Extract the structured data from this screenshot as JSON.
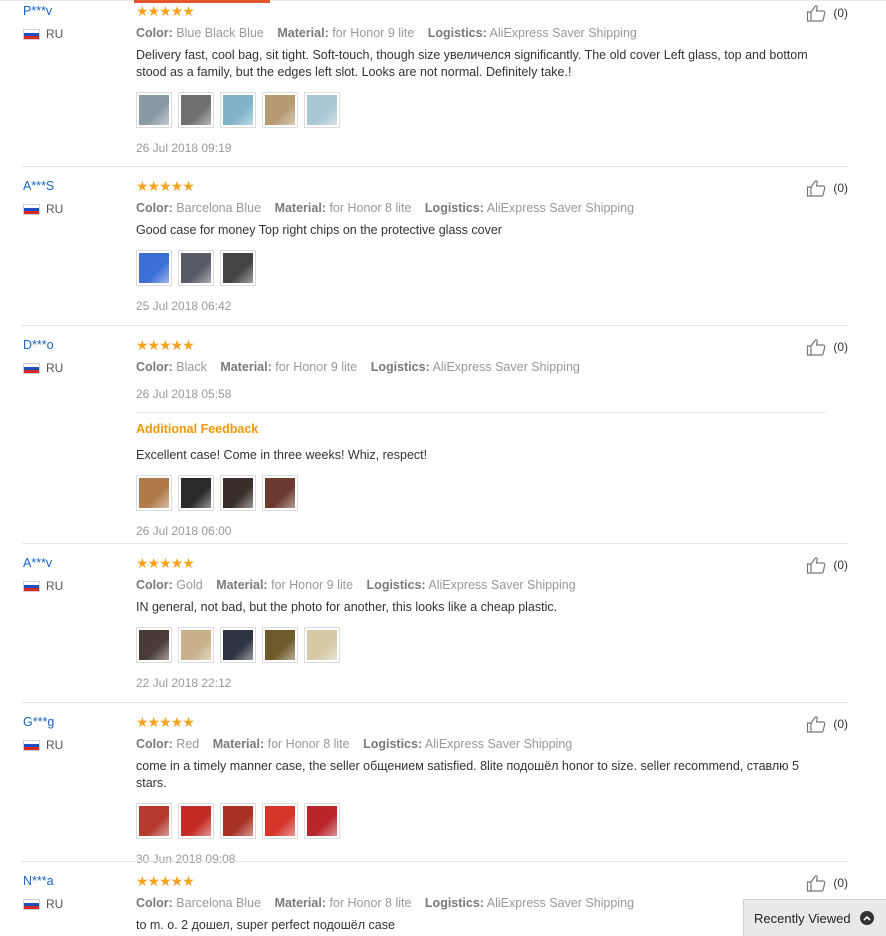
{
  "labels": {
    "color": "Color:",
    "material": "Material:",
    "logistics": "Logistics:",
    "additional_feedback": "Additional Feedback",
    "recently_viewed": "Recently Viewed"
  },
  "reviews": [
    {
      "user": "P***v",
      "country": "RU",
      "stars": "★★★★★",
      "color": "Blue Black Blue",
      "material": "for Honor 9 lite",
      "logistics": "AliExpress Saver Shipping",
      "text": "Delivery fast, cool bag, sit tight. Soft-touch, though size увеличелся significantly. The old cover Left glass, top and bottom stood as a family, but the edges left slot. Looks are not normal. Definitely take.!",
      "photos": [
        "#8a9aa5",
        "#6f6f6f",
        "#7fb3c9",
        "#b59a72",
        "#a8c6d3"
      ],
      "date": "26 Jul 2018 09:19",
      "likes": "(0)"
    },
    {
      "user": "A***S",
      "country": "RU",
      "stars": "★★★★★",
      "color": "Barcelona Blue",
      "material": "for Honor 8 lite",
      "logistics": "AliExpress Saver Shipping",
      "text": "Good case for money Top right chips on the protective glass cover",
      "photos": [
        "#3b6fd6",
        "#555a66",
        "#444444"
      ],
      "date": "25 Jul 2018 06:42",
      "likes": "(0)"
    },
    {
      "user": "D***o",
      "country": "RU",
      "stars": "★★★★★",
      "color": "Black",
      "material": "for Honor 9 lite",
      "logistics": "AliExpress Saver Shipping",
      "date": "26 Jul 2018 05:58",
      "likes": "(0)",
      "additional": {
        "text": "Excellent case! Come in three weeks! Whiz, respect!",
        "photos": [
          "#b07a4a",
          "#2a2a2a",
          "#3a2f2a",
          "#6b3a2e"
        ],
        "date": "26 Jul 2018 06:00"
      }
    },
    {
      "user": "A***v",
      "country": "RU",
      "stars": "★★★★★",
      "color": "Gold",
      "material": "for Honor 9 lite",
      "logistics": "AliExpress Saver Shipping",
      "text": "IN general, not bad, but the photo for another, this looks like a cheap plastic.",
      "photos": [
        "#4a3b36",
        "#c7b08a",
        "#2e3442",
        "#6f5a2c",
        "#d5c9a6"
      ],
      "date": "22 Jul 2018 22:12",
      "likes": "(0)"
    },
    {
      "user": "G***g",
      "country": "RU",
      "stars": "★★★★★",
      "color": "Red",
      "material": "for Honor 8 lite",
      "logistics": "AliExpress Saver Shipping",
      "text": "come in a timely manner case, the seller общением satisfied. 8lite подошёл honor to size. seller recommend, ставлю 5 stars.",
      "photos": [
        "#b33a2c",
        "#c42b25",
        "#a93124",
        "#d6352a",
        "#b8262a"
      ],
      "date": "30 Jun 2018 09:08",
      "likes": "(0)"
    },
    {
      "user": "N***a",
      "country": "RU",
      "stars": "★★★★★",
      "color": "Barcelona Blue",
      "material": "for Honor 8 lite",
      "logistics": "AliExpress Saver Shipping",
      "text": "to m. o. 2 дошел, super perfect подошёл case",
      "likes": "(0)"
    }
  ]
}
